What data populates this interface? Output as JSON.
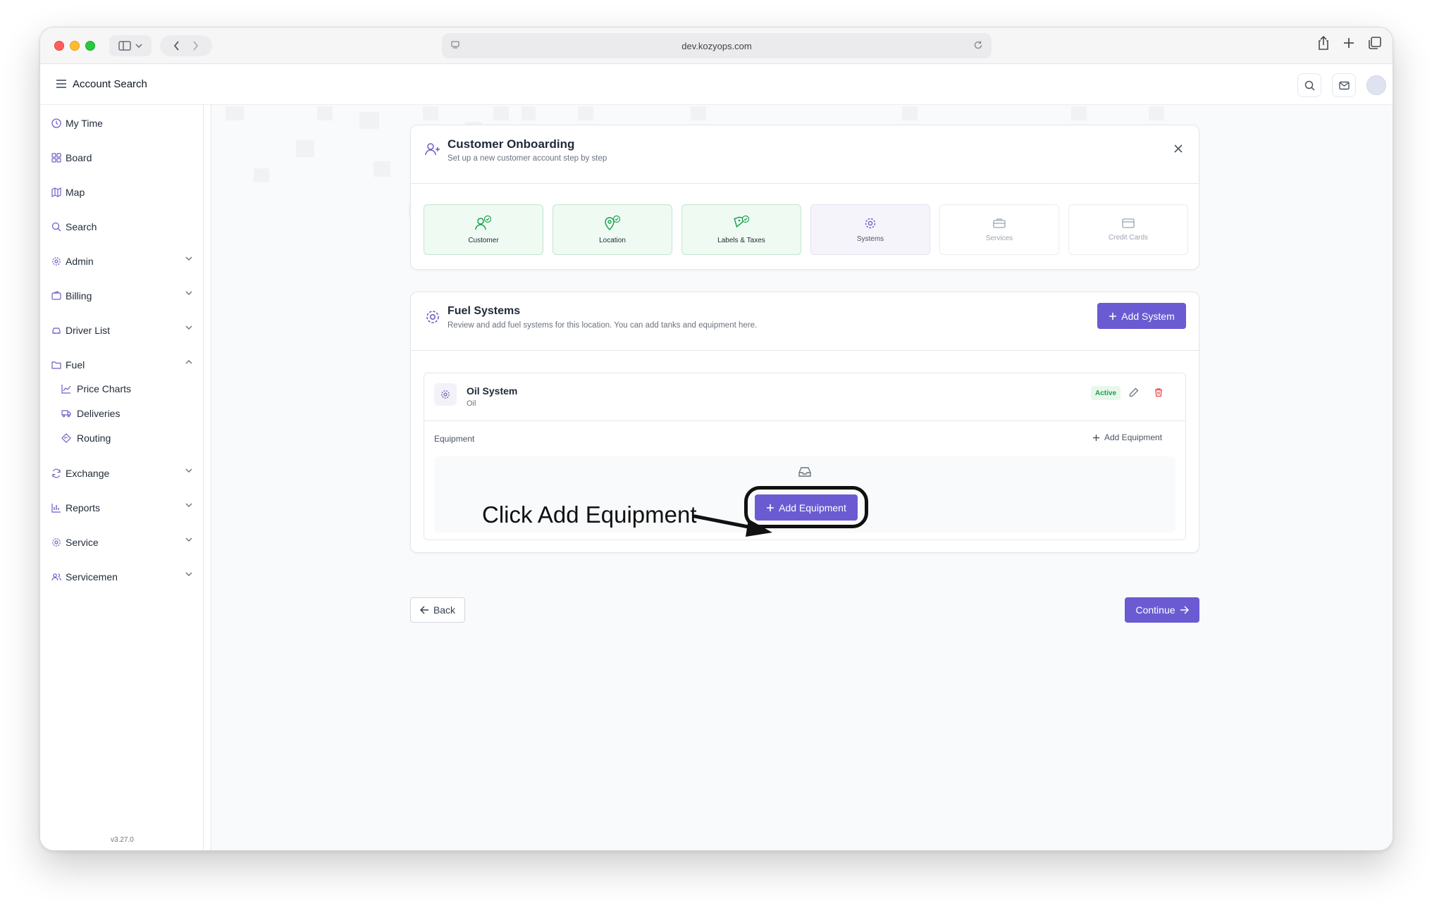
{
  "browser": {
    "url": "dev.kozyops.com"
  },
  "header": {
    "title": "Account Search"
  },
  "sidebar": {
    "items": [
      {
        "label": "My Time",
        "icon": "clock-icon"
      },
      {
        "label": "Board",
        "icon": "grid-icon"
      },
      {
        "label": "Map",
        "icon": "map-icon"
      },
      {
        "label": "Search",
        "icon": "search-icon"
      },
      {
        "label": "Admin",
        "icon": "gear-icon",
        "expandable": true
      },
      {
        "label": "Billing",
        "icon": "wallet-icon",
        "expandable": true
      },
      {
        "label": "Driver List",
        "icon": "car-icon",
        "expandable": true
      },
      {
        "label": "Fuel",
        "icon": "folder-icon",
        "expanded": true
      },
      {
        "label": "Exchange",
        "icon": "refresh-icon",
        "expandable": true
      },
      {
        "label": "Reports",
        "icon": "bar-chart-icon",
        "expandable": true
      },
      {
        "label": "Service",
        "icon": "gear-icon",
        "expandable": true
      },
      {
        "label": "Servicemen",
        "icon": "users-icon",
        "expandable": true
      }
    ],
    "fuel_subitems": [
      {
        "label": "Price Charts",
        "icon": "line-chart-icon"
      },
      {
        "label": "Deliveries",
        "icon": "truck-icon"
      },
      {
        "label": "Routing",
        "icon": "route-icon"
      }
    ],
    "version": "v3.27.0"
  },
  "onboarding": {
    "title": "Customer Onboarding",
    "subtitle": "Set up a new customer account step by step",
    "steps": [
      {
        "label": "Customer",
        "status": "done"
      },
      {
        "label": "Location",
        "status": "done"
      },
      {
        "label": "Labels & Taxes",
        "status": "done"
      },
      {
        "label": "Systems",
        "status": "current"
      },
      {
        "label": "Services",
        "status": "pending"
      },
      {
        "label": "Credit Cards",
        "status": "pending"
      }
    ]
  },
  "fuel_systems": {
    "title": "Fuel Systems",
    "subtitle": "Review and add fuel systems for this location. You can add tanks and equipment here.",
    "add_system_label": "Add System",
    "system": {
      "name": "Oil System",
      "type": "Oil",
      "status": "Active",
      "equipment_label": "Equipment",
      "add_equipment_link": "Add Equipment",
      "add_equipment_button": "Add Equipment"
    }
  },
  "annotation": {
    "text": "Click Add Equipment"
  },
  "footer": {
    "back_label": "Back",
    "continue_label": "Continue"
  },
  "colors": {
    "accent": "#6b5bd2",
    "success": "#16a34a",
    "danger": "#ef4444"
  }
}
